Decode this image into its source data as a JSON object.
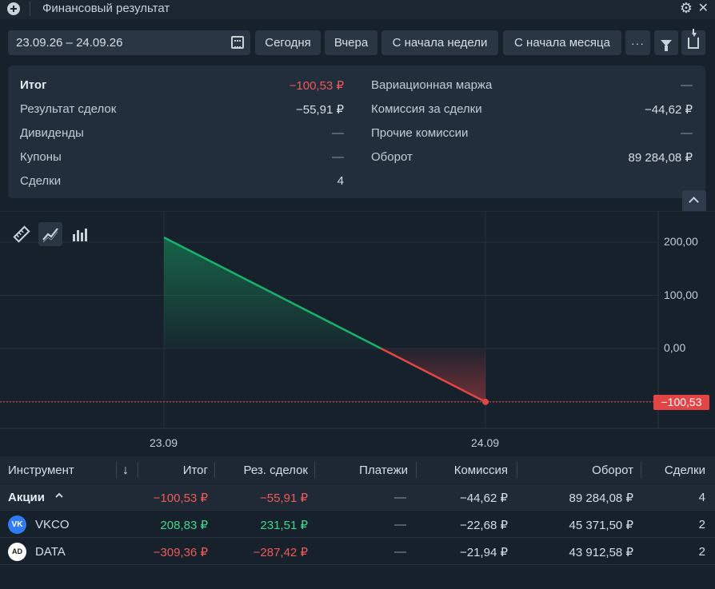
{
  "window": {
    "title": "Финансовый результат"
  },
  "toolbar": {
    "date_range": "23.09.26 – 24.09.26",
    "today": "Сегодня",
    "yesterday": "Вчера",
    "week": "С начала недели",
    "month": "С начала месяца",
    "more": "···"
  },
  "summary": {
    "left": [
      {
        "label": "Итог",
        "value": "−100,53 ₽"
      },
      {
        "label": "Результат сделок",
        "value": "−55,91 ₽"
      },
      {
        "label": "Дивиденды",
        "value": "—"
      },
      {
        "label": "Купоны",
        "value": "—"
      },
      {
        "label": "Сделки",
        "value": "4"
      }
    ],
    "right": [
      {
        "label": "Вариационная маржа",
        "value": "—"
      },
      {
        "label": "Комиссия за сделки",
        "value": "−44,62 ₽"
      },
      {
        "label": "Прочие комиссии",
        "value": "—"
      },
      {
        "label": "Оборот",
        "value": "89 284,08 ₽"
      }
    ]
  },
  "chart_data": {
    "type": "area",
    "x": [
      "23.09",
      "24.09"
    ],
    "values": [
      208.83,
      -100.53
    ],
    "y_ticks": [
      "200,00",
      "100,00",
      "0,00"
    ],
    "ylim": [
      -150,
      250
    ],
    "current_value_label": "−100,53",
    "positive_color": "#16b46a",
    "negative_color": "#e24545"
  },
  "table": {
    "headers": [
      "Инструмент",
      "Итог",
      "Рез. сделок",
      "Платежи",
      "Комиссия",
      "Оборот",
      "Сделки"
    ],
    "group": {
      "name": "Акции",
      "total": "−100,53 ₽",
      "trades_result": "−55,91 ₽",
      "payments": "—",
      "commission": "−44,62 ₽",
      "turnover": "89 284,08 ₽",
      "deals": "4"
    },
    "rows": [
      {
        "ticker": "VKCO",
        "icon": "vk-logo-icon",
        "icon_text": "VK",
        "total": "208,83 ₽",
        "trades_result": "231,51 ₽",
        "payments": "—",
        "commission": "−22,68 ₽",
        "turnover": "45 371,50 ₽",
        "deals": "2"
      },
      {
        "ticker": "DATA",
        "icon": "arenadata-logo-icon",
        "icon_text": "AD",
        "total": "−309,36 ₽",
        "trades_result": "−287,42 ₽",
        "payments": "—",
        "commission": "−21,94 ₽",
        "turnover": "43 912,58 ₽",
        "deals": "2"
      }
    ]
  },
  "colors": {
    "background": "#17212c",
    "panel": "#222e3b",
    "negative": "#ee5a5a",
    "positive": "#3fd88c"
  }
}
